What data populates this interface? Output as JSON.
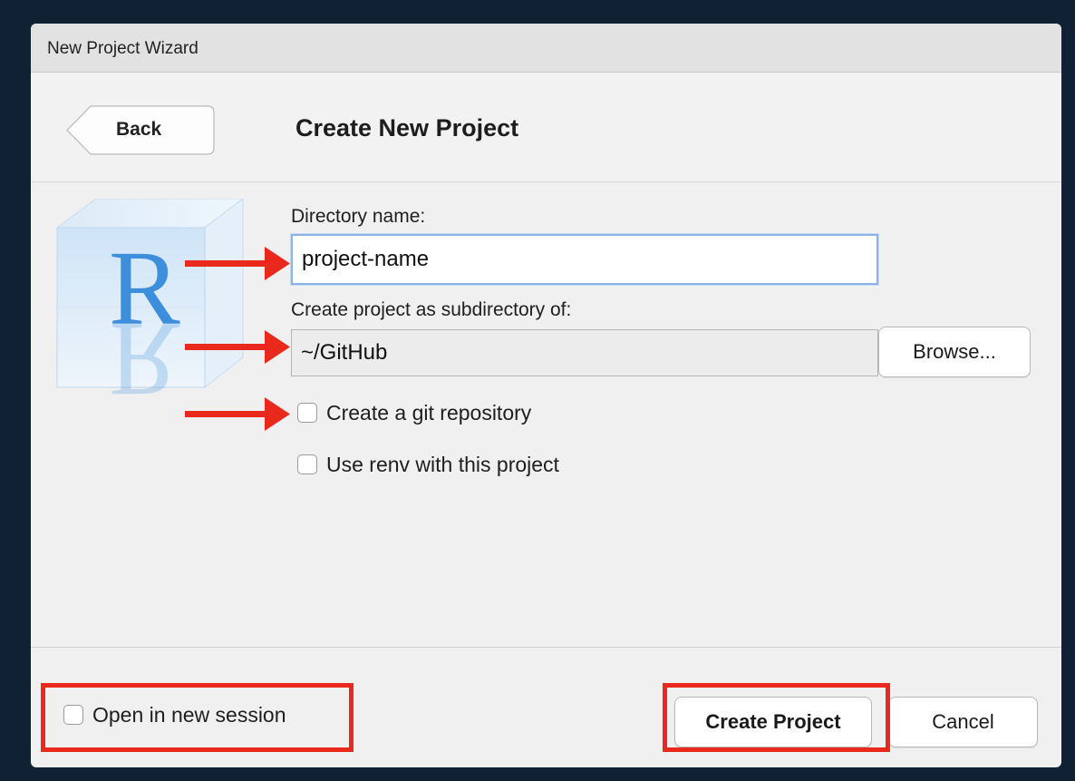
{
  "window": {
    "title": "New Project Wizard"
  },
  "header": {
    "back_label": "Back",
    "title": "Create New Project"
  },
  "logo": {
    "letter": "R"
  },
  "form": {
    "directory_label": "Directory name:",
    "directory_value": "project-name",
    "subdir_label": "Create project as subdirectory of:",
    "subdir_value": "~/GitHub",
    "browse_label": "Browse...",
    "git_label": "Create a git repository",
    "git_checked": false,
    "renv_label": "Use renv with this project",
    "renv_checked": false
  },
  "footer": {
    "new_session_label": "Open in new session",
    "new_session_checked": false,
    "create_label": "Create Project",
    "cancel_label": "Cancel"
  },
  "colors": {
    "annotation": "#e9291b",
    "focus_border": "#8bb3e8",
    "background": "#0f2133"
  }
}
